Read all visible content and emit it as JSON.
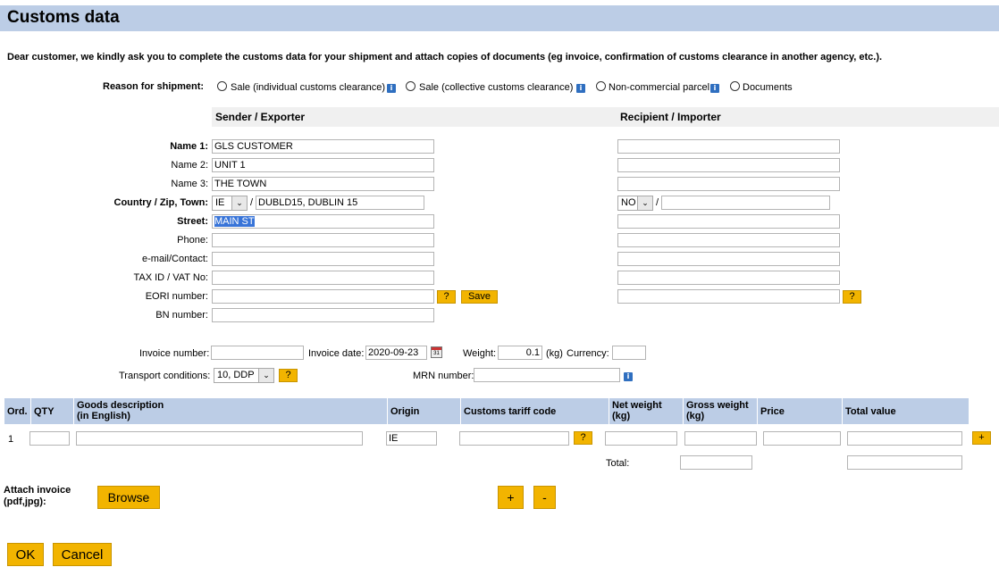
{
  "page": {
    "title": "Customs data",
    "intro": "Dear customer, we kindly ask you to complete the customs data for your shipment and attach copies of documents (eg invoice, confirmation of customs clearance in another agency, etc.)."
  },
  "reason": {
    "label": "Reason for shipment:",
    "options": [
      "Sale (individual customs clearance)",
      "Sale (collective customs clearance)",
      "Non-commercial parcel",
      "Documents"
    ]
  },
  "sender": {
    "heading": "Sender / Exporter",
    "labels": {
      "name1": "Name 1:",
      "name2": "Name 2:",
      "name3": "Name 3:",
      "country": "Country / Zip, Town:",
      "street": "Street:",
      "phone": "Phone:",
      "email": "e-mail/Contact:",
      "tax": "TAX ID / VAT No:",
      "eori": "EORI number:",
      "bn": "BN number:"
    },
    "values": {
      "name1": "GLS CUSTOMER",
      "name2": "UNIT 1",
      "name3": "THE TOWN",
      "country": "IE",
      "zip_town": "DUBLD15, DUBLIN 15",
      "street": "MAIN ST",
      "phone": "",
      "email": "",
      "tax": "",
      "eori": "",
      "bn": ""
    },
    "slash": "/",
    "help_label": "?",
    "save_label": "Save"
  },
  "recipient": {
    "heading": "Recipient / Importer",
    "values": {
      "country": "NO",
      "zip_town": ""
    },
    "slash": "/",
    "help_label": "?"
  },
  "invoice": {
    "number_label": "Invoice number:",
    "number": "",
    "date_label": "Invoice date:",
    "date": "2020-09-23",
    "weight_label": "Weight:",
    "weight": "0.1",
    "weight_unit": "(kg)",
    "currency_label": "Currency:",
    "currency": "",
    "transport_label": "Transport conditions:",
    "transport": "10, DDP",
    "transport_help": "?",
    "mrn_label": "MRN number:",
    "mrn": ""
  },
  "goods": {
    "headers": [
      "Ord.",
      "QTY",
      "Goods description\n(in English)",
      "Origin",
      "Customs tariff code",
      "Net weight\n(kg)",
      "Gross weight\n(kg)",
      "Price",
      "Total value"
    ],
    "rows": [
      {
        "ord": "1",
        "qty": "",
        "desc": "",
        "origin": "IE",
        "tariff": "",
        "net": "",
        "gross": "",
        "price": "",
        "total": ""
      }
    ],
    "help_label": "?",
    "add_row_label": "+",
    "total_label": "Total:"
  },
  "attach": {
    "label": "Attach invoice\n(pdf,jpg):",
    "browse_label": "Browse",
    "plus_label": "+",
    "minus_label": "-"
  },
  "actions": {
    "ok_label": "OK",
    "cancel_label": "Cancel"
  },
  "colors": {
    "header_bg": "#bccde6",
    "button_yellow": "#f2b400",
    "info_blue": "#2f6fc0"
  }
}
